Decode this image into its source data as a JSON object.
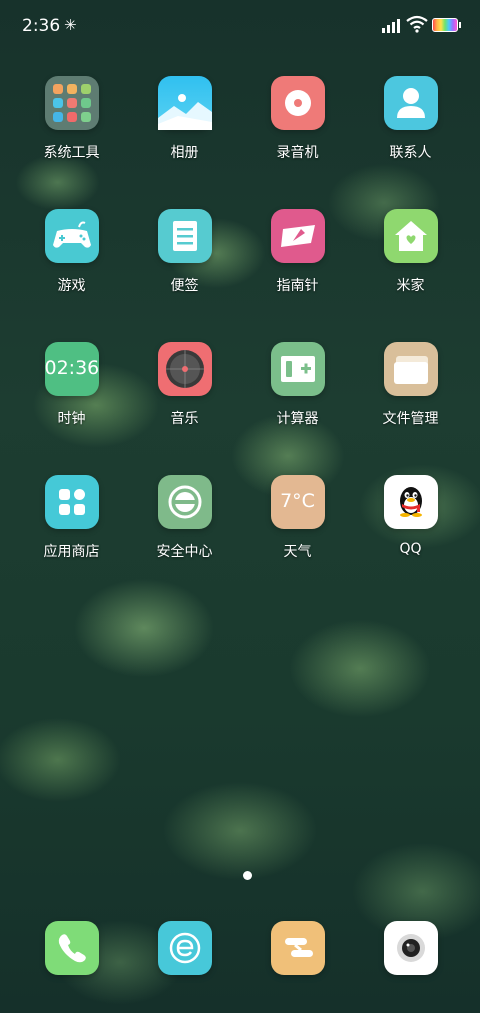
{
  "status_bar": {
    "time": "2:36",
    "bluetooth_icon": "bluetooth-icon",
    "signal_icon": "signal-icon",
    "wifi_icon": "wifi-icon",
    "battery_icon": "battery-icon"
  },
  "apps": [
    {
      "label": "系统工具",
      "icon": "folder-icon",
      "color": "#5e7c72"
    },
    {
      "label": "相册",
      "icon": "gallery-icon",
      "color": "#3bc6f0"
    },
    {
      "label": "录音机",
      "icon": "recorder-icon",
      "color": "#ef7a78"
    },
    {
      "label": "联系人",
      "icon": "contacts-icon",
      "color": "#4cc7df"
    },
    {
      "label": "游戏",
      "icon": "gamepad-icon",
      "color": "#49c9d2"
    },
    {
      "label": "便签",
      "icon": "notes-icon",
      "color": "#56cbd0"
    },
    {
      "label": "指南针",
      "icon": "compass-icon",
      "color": "#e05a8d"
    },
    {
      "label": "米家",
      "icon": "home-icon",
      "color": "#8fd86f"
    },
    {
      "label": "时钟",
      "icon": "clock-icon",
      "clock_text": "02:36",
      "color": "#4fbf83"
    },
    {
      "label": "音乐",
      "icon": "music-icon",
      "color": "#ef6e72"
    },
    {
      "label": "计算器",
      "icon": "calculator-icon",
      "color": "#7bbf8b"
    },
    {
      "label": "文件管理",
      "icon": "folder-files-icon",
      "color": "#d9bf9a"
    },
    {
      "label": "应用商店",
      "icon": "app-store-icon",
      "color": "#45c9d7"
    },
    {
      "label": "安全中心",
      "icon": "security-icon",
      "color": "#7fba8a"
    },
    {
      "label": "天气",
      "icon": "weather-icon",
      "weather_text": "7°C",
      "color": "#e3b892"
    },
    {
      "label": "QQ",
      "icon": "qq-penguin-icon",
      "color": "#ffffff"
    }
  ],
  "dock": [
    {
      "icon": "phone-icon",
      "color": "#7fdc78"
    },
    {
      "icon": "browser-icon",
      "color": "#47c8d9"
    },
    {
      "icon": "messages-icon",
      "color": "#f0c079"
    },
    {
      "icon": "camera-icon",
      "color": "#ffffff"
    }
  ],
  "page_indicator": {
    "current": 1,
    "total": 1
  }
}
